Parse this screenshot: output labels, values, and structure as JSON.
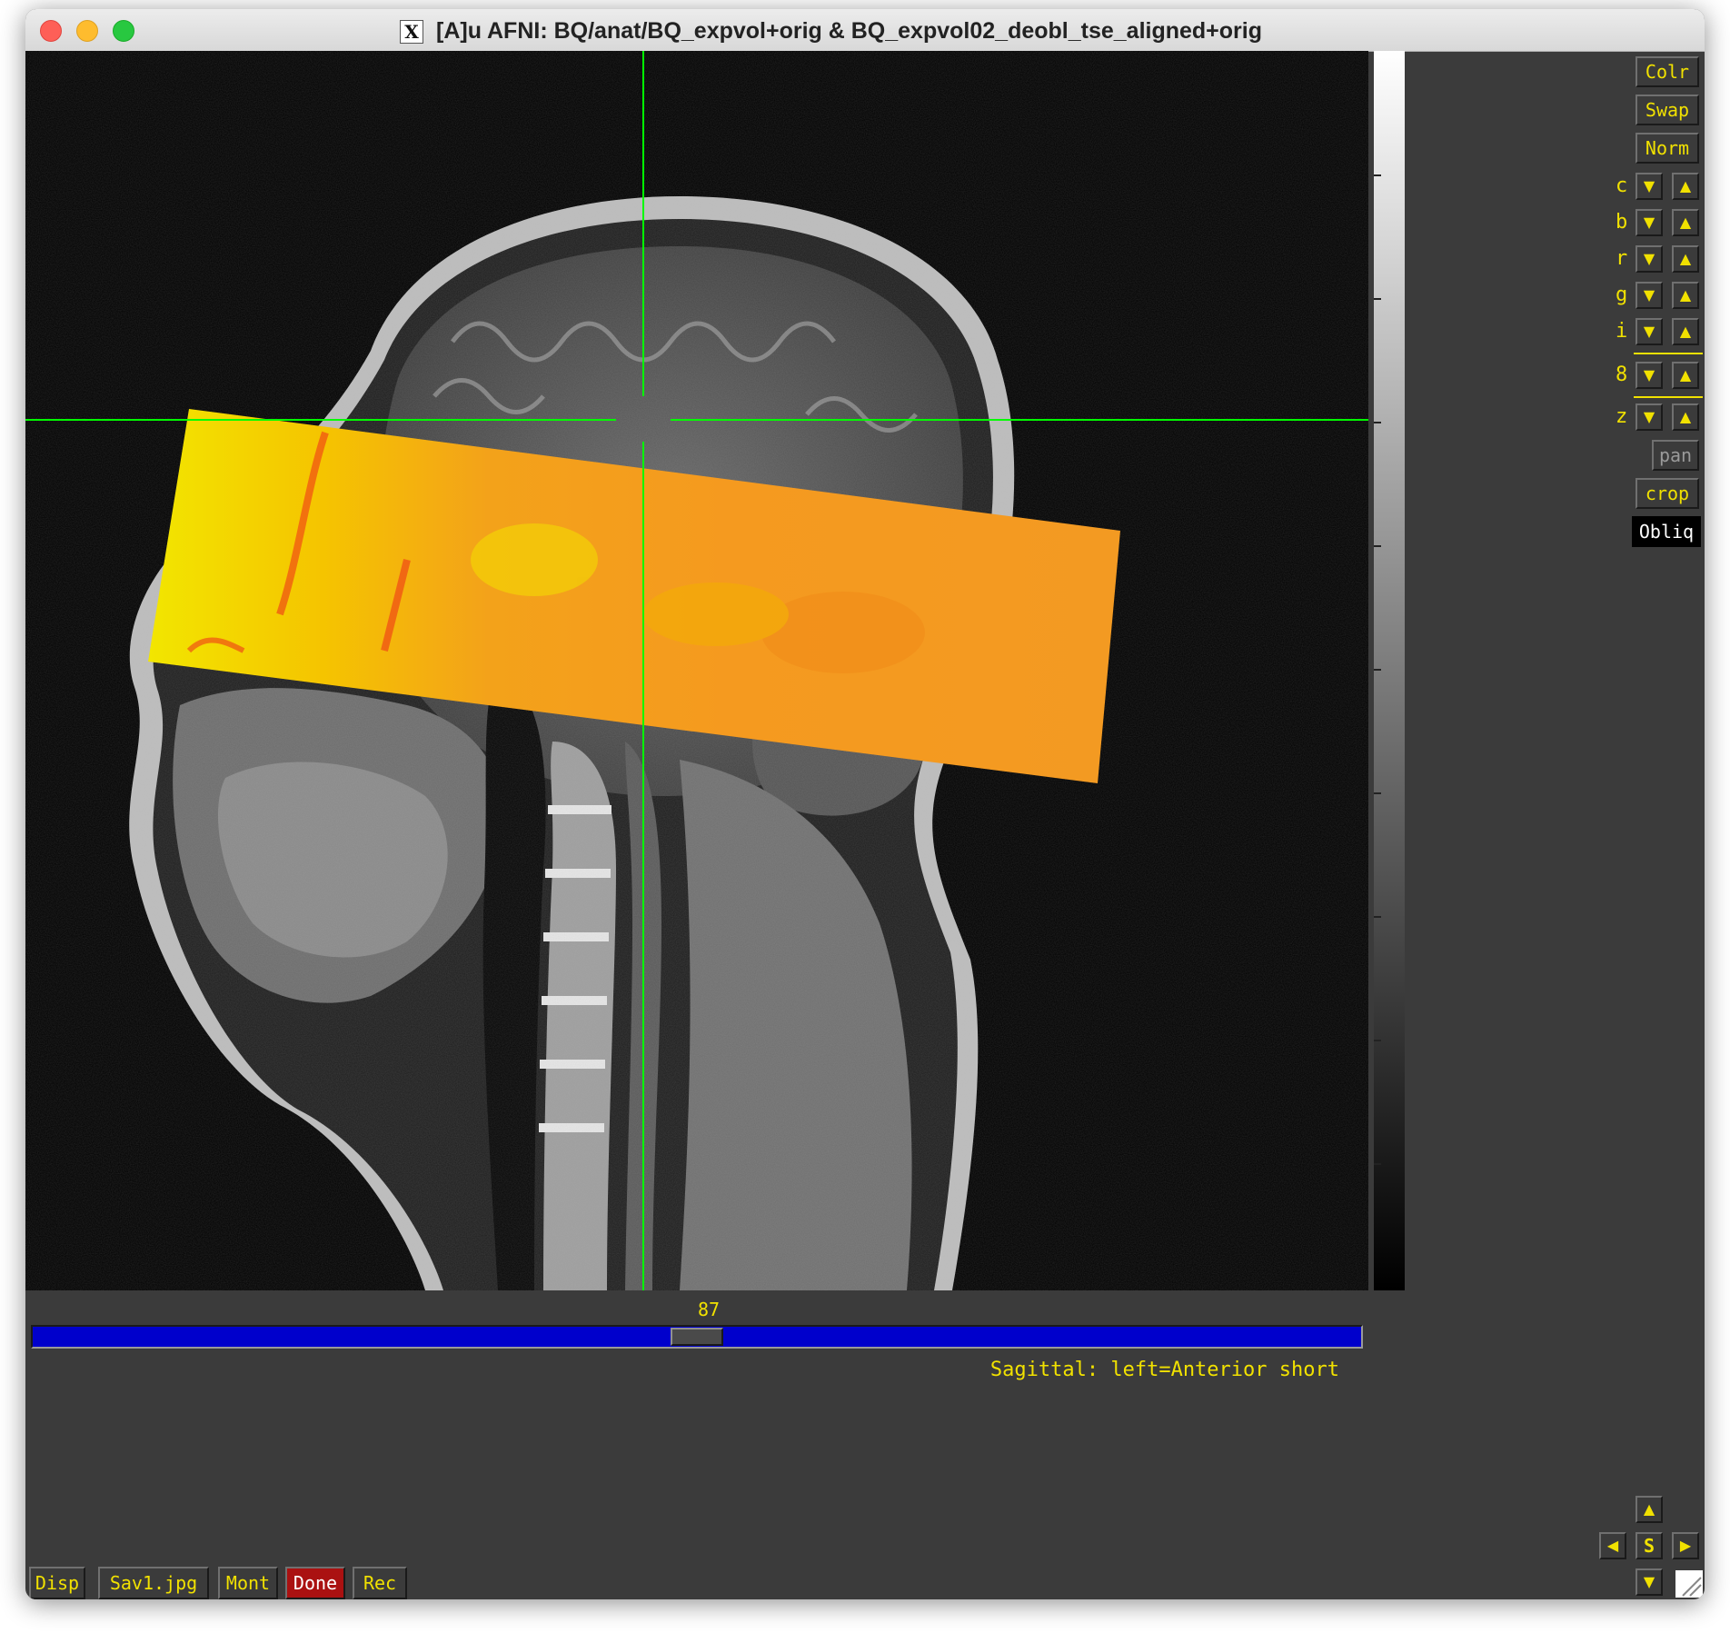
{
  "window": {
    "title": "[A]u AFNI: BQ/anat/BQ_expvol+orig & BQ_expvol02_deobl_tse_aligned+orig",
    "x_icon_label": "X"
  },
  "right_panel": {
    "buttons": {
      "colr": "Colr",
      "swap": "Swap",
      "norm": "Norm",
      "pan": "pan",
      "crop": "crop",
      "obliq": "Obliq"
    },
    "controls": [
      "c",
      "b",
      "r",
      "g",
      "i",
      "8",
      "z"
    ]
  },
  "slice": {
    "index": "87",
    "position_fraction": 0.5
  },
  "orientation": "Sagittal: left=Anterior short",
  "bottom_buttons": {
    "disp": "Disp",
    "save": "Sav1.jpg",
    "mont": "Mont",
    "done": "Done",
    "rec": "Rec"
  },
  "nav_pad": {
    "center": "S"
  },
  "colors": {
    "label_yellow": "#f1e100",
    "crosshair_green": "#00ff00",
    "slider_blue": "#0000cc",
    "done_red": "#aa1111"
  }
}
